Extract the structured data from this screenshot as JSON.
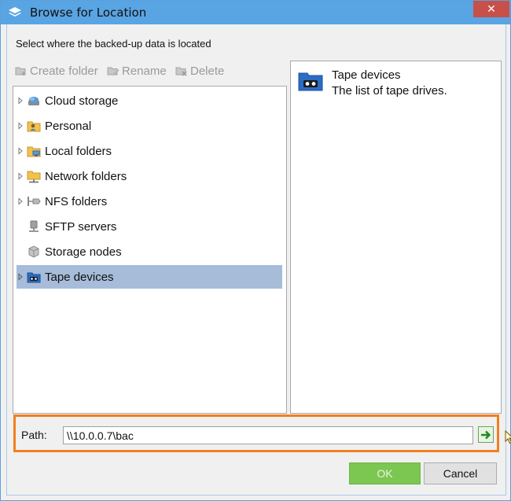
{
  "window": {
    "title": "Browse for Location",
    "close_label": "✕"
  },
  "dialog": {
    "subtitle": "Select where the backed-up data is located"
  },
  "toolbar": {
    "create_folder": "Create folder",
    "rename": "Rename",
    "delete": "Delete"
  },
  "tree": {
    "items": [
      {
        "label": "Cloud storage",
        "icon": "cloud-icon",
        "expandable": true,
        "selected": false
      },
      {
        "label": "Personal",
        "icon": "personal-folder-icon",
        "expandable": true,
        "selected": false
      },
      {
        "label": "Local folders",
        "icon": "local-folder-icon",
        "expandable": true,
        "selected": false
      },
      {
        "label": "Network folders",
        "icon": "network-folder-icon",
        "expandable": true,
        "selected": false
      },
      {
        "label": "NFS folders",
        "icon": "nfs-icon",
        "expandable": true,
        "selected": false
      },
      {
        "label": "SFTP servers",
        "icon": "sftp-server-icon",
        "expandable": false,
        "selected": false
      },
      {
        "label": "Storage nodes",
        "icon": "storage-node-icon",
        "expandable": false,
        "selected": false
      },
      {
        "label": "Tape devices",
        "icon": "tape-device-icon",
        "expandable": true,
        "selected": true
      }
    ]
  },
  "info": {
    "title": "Tape devices",
    "description": "The list of tape drives."
  },
  "path": {
    "label": "Path:",
    "value": "\\\\10.0.0.7\\bac"
  },
  "buttons": {
    "ok": "OK",
    "cancel": "Cancel"
  },
  "colors": {
    "titlebar": "#59a4e3",
    "highlight": "#f08020",
    "ok_button": "#7cc652",
    "selection": "#a6bcd9"
  }
}
